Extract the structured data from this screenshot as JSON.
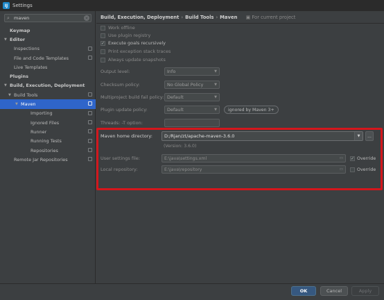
{
  "window": {
    "title": "Settings",
    "icon": "intellij-app-icon"
  },
  "search": {
    "value": "maven",
    "icon": "search-icon",
    "clear_icon": "clear-icon"
  },
  "tree": [
    {
      "label": "Keymap",
      "level": 0,
      "bold": true,
      "arrow": "",
      "project": false,
      "selected": false
    },
    {
      "label": "Editor",
      "level": 0,
      "bold": true,
      "arrow": "▼",
      "project": false,
      "selected": false
    },
    {
      "label": "Inspections",
      "level": 1,
      "bold": false,
      "arrow": "",
      "project": true,
      "selected": false
    },
    {
      "label": "File and Code Templates",
      "level": 1,
      "bold": false,
      "arrow": "",
      "project": true,
      "selected": false
    },
    {
      "label": "Live Templates",
      "level": 1,
      "bold": false,
      "arrow": "",
      "project": false,
      "selected": false
    },
    {
      "label": "Plugins",
      "level": 0,
      "bold": true,
      "arrow": "",
      "project": false,
      "selected": false
    },
    {
      "label": "Build, Execution, Deployment",
      "level": 0,
      "bold": true,
      "arrow": "▼",
      "project": false,
      "selected": false
    },
    {
      "label": "Build Tools",
      "level": 1,
      "bold": false,
      "arrow": "▼",
      "project": true,
      "selected": false
    },
    {
      "label": "Maven",
      "level": 2,
      "bold": false,
      "arrow": "▼",
      "project": true,
      "selected": true
    },
    {
      "label": "Importing",
      "level": 3,
      "bold": false,
      "arrow": "",
      "project": true,
      "selected": false
    },
    {
      "label": "Ignored Files",
      "level": 3,
      "bold": false,
      "arrow": "",
      "project": true,
      "selected": false
    },
    {
      "label": "Runner",
      "level": 3,
      "bold": false,
      "arrow": "",
      "project": true,
      "selected": false
    },
    {
      "label": "Running Tests",
      "level": 3,
      "bold": false,
      "arrow": "",
      "project": true,
      "selected": false
    },
    {
      "label": "Repositories",
      "level": 3,
      "bold": false,
      "arrow": "",
      "project": true,
      "selected": false
    },
    {
      "label": "Remote Jar Repositories",
      "level": 1,
      "bold": false,
      "arrow": "",
      "project": true,
      "selected": false
    }
  ],
  "breadcrumb": {
    "parts": [
      "Build, Execution, Deployment",
      "Build Tools",
      "Maven"
    ],
    "separator": "›",
    "project_note": "For current project"
  },
  "checkboxes": [
    {
      "label": "Work offline",
      "checked": false
    },
    {
      "label": "Use plugin registry",
      "checked": false
    },
    {
      "label": "Execute goals recursively",
      "checked": true
    },
    {
      "label": "Print exception stack traces",
      "checked": false
    },
    {
      "label": "Always update snapshots",
      "checked": false
    }
  ],
  "selects": [
    {
      "label": "Output level:",
      "value": "Info",
      "badge": ""
    },
    {
      "label": "Checksum policy:",
      "value": "No Global Policy",
      "badge": ""
    },
    {
      "label": "Multiproject build fail policy:",
      "value": "Default",
      "badge": ""
    },
    {
      "label": "Plugin update policy:",
      "value": "Default",
      "badge": "ignored by Maven 3+"
    }
  ],
  "threads": {
    "label": "Threads: -T option:",
    "value": ""
  },
  "maven_home": {
    "label": "Maven home directory:",
    "value": "D:/Rjan/zt/apache-maven-3.6.0",
    "browse": "...",
    "version": "(Version: 3.6.0)"
  },
  "user_settings": {
    "label": "User settings file:",
    "value": "E:\\java\\settings.xml",
    "override_label": "Override",
    "override_checked": true
  },
  "local_repo": {
    "label": "Local repository:",
    "value": "E:\\java\\repository",
    "override_label": "Override",
    "override_checked": false
  },
  "buttons": {
    "ok": "OK",
    "cancel": "Cancel",
    "apply": "Apply",
    "help": "?"
  },
  "colors": {
    "highlight": "#d4161c",
    "selection": "#2f65ca",
    "ok_button": "#365880"
  }
}
